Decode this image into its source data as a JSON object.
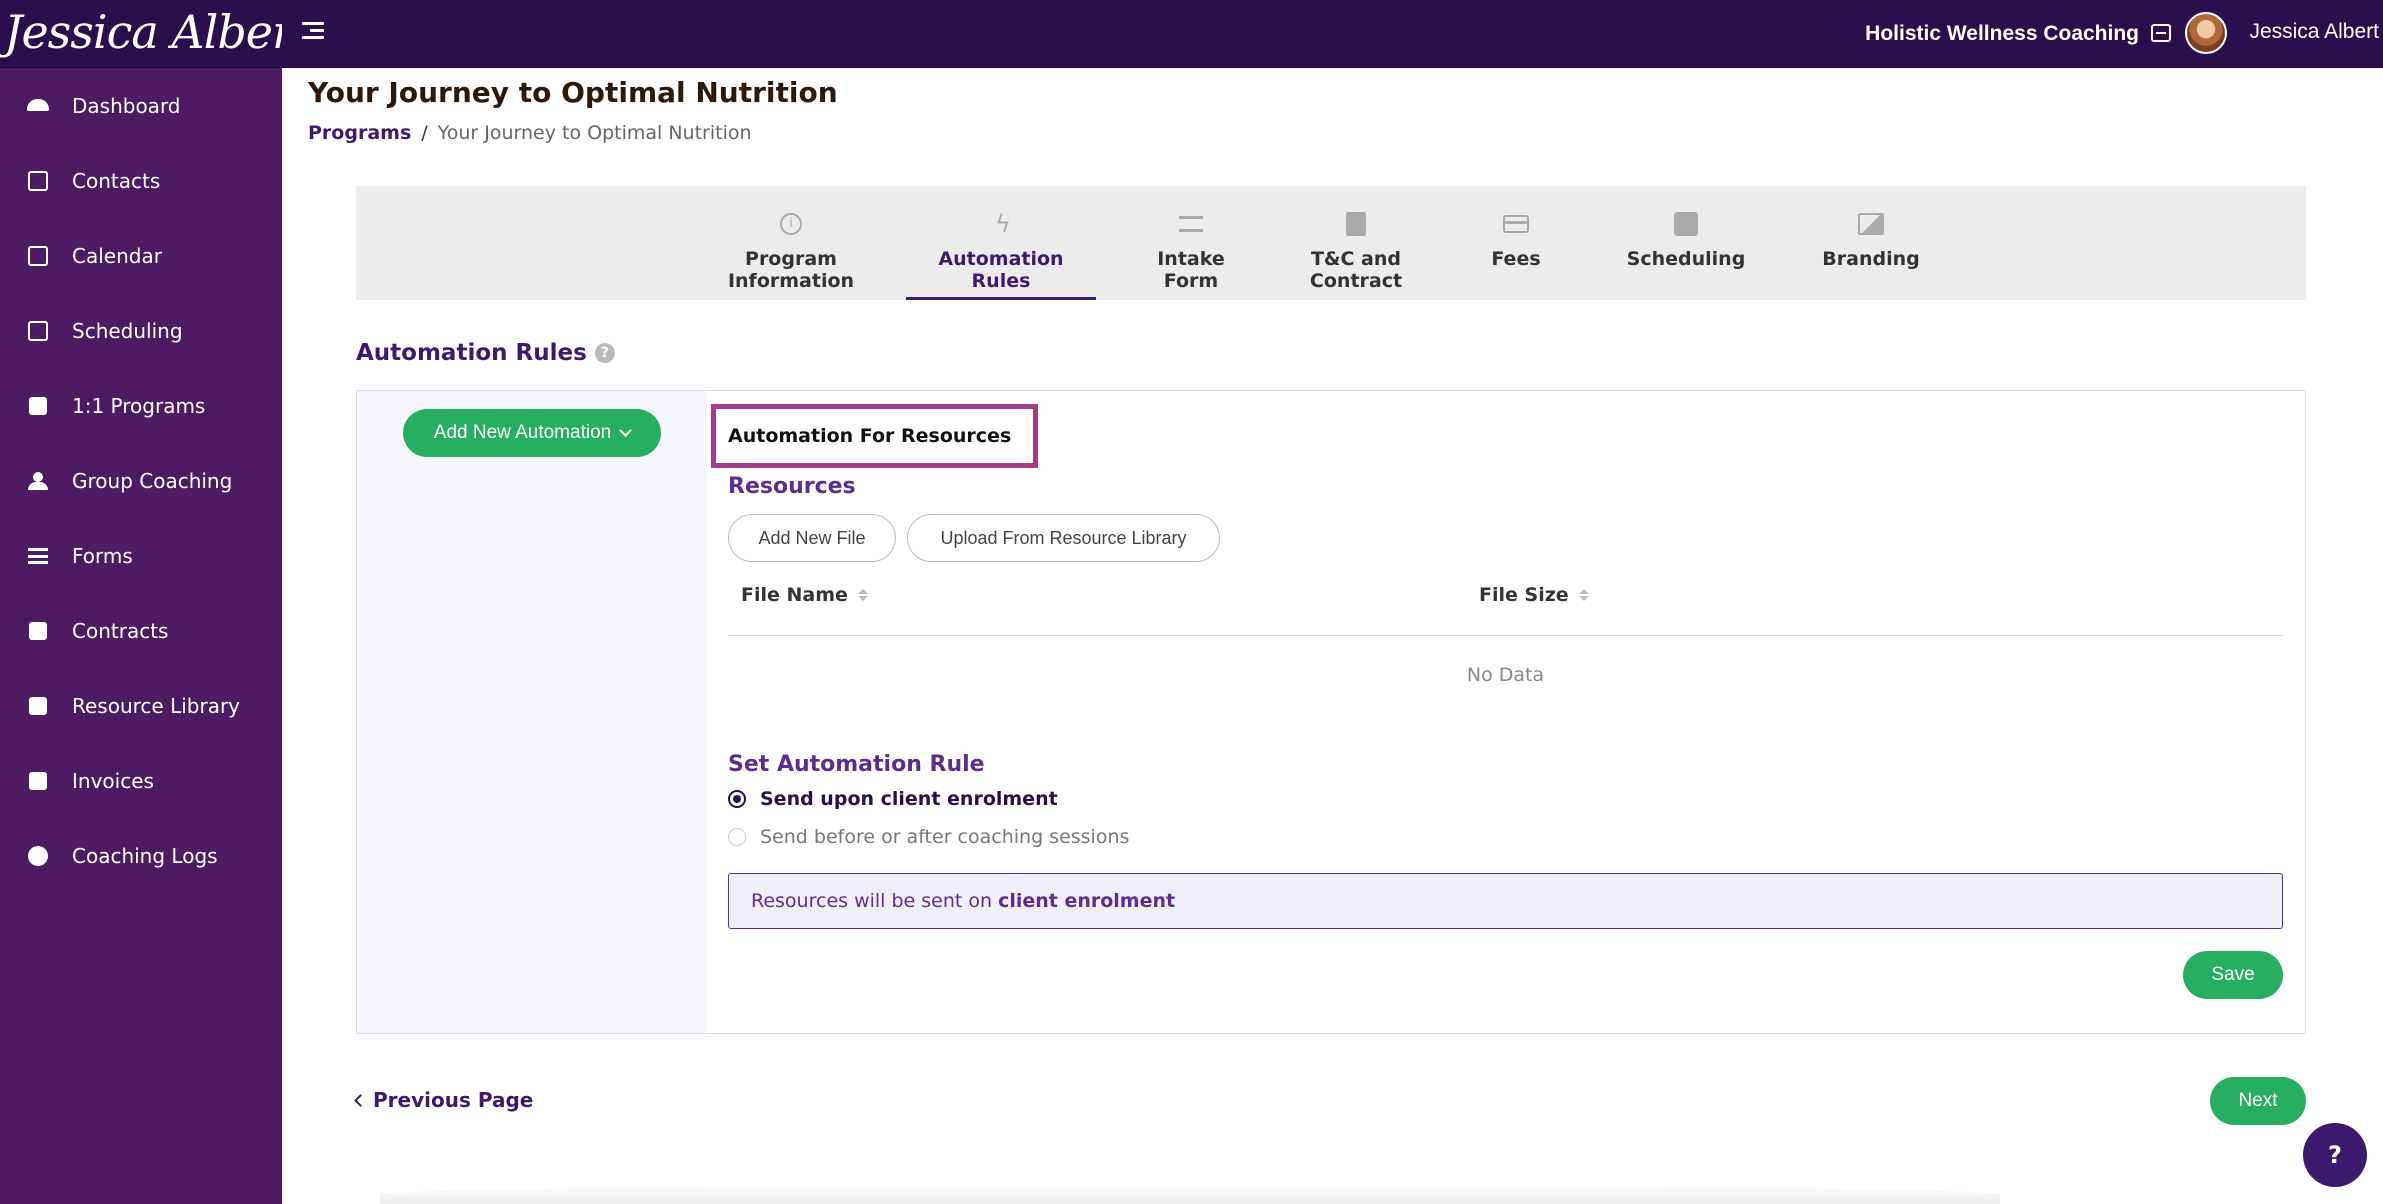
{
  "brand": {
    "logo_text": "Jessica Albert"
  },
  "topbar": {
    "org_name": "Holistic Wellness Coaching",
    "user_name": "Jessica Albert"
  },
  "sidebar": {
    "items": [
      {
        "label": "Dashboard",
        "icon": "dashboard-icon"
      },
      {
        "label": "Contacts",
        "icon": "contacts-icon"
      },
      {
        "label": "Calendar",
        "icon": "calendar-icon"
      },
      {
        "label": "Scheduling",
        "icon": "scheduling-icon"
      },
      {
        "label": "1:1 Programs",
        "icon": "book-icon"
      },
      {
        "label": "Group Coaching",
        "icon": "group-icon"
      },
      {
        "label": "Forms",
        "icon": "forms-icon"
      },
      {
        "label": "Contracts",
        "icon": "contract-sign-icon"
      },
      {
        "label": "Resource Library",
        "icon": "library-icon"
      },
      {
        "label": "Invoices",
        "icon": "invoice-icon"
      },
      {
        "label": "Coaching Logs",
        "icon": "clock-icon"
      }
    ]
  },
  "page": {
    "title": "Your Journey to Optimal Nutrition",
    "breadcrumb": {
      "link": "Programs",
      "separator": "/",
      "current": "Your Journey to Optimal Nutrition"
    }
  },
  "steps": [
    {
      "label": "Program\nInformation",
      "icon": "info-icon",
      "active": false
    },
    {
      "label": "Automation\nRules",
      "icon": "lightning-icon",
      "active": true
    },
    {
      "label": "Intake\nForm",
      "icon": "checklist-icon",
      "active": false
    },
    {
      "label": "T&C and\nContract",
      "icon": "contract-icon",
      "active": false
    },
    {
      "label": "Fees",
      "icon": "credit-card-icon",
      "active": false
    },
    {
      "label": "Scheduling",
      "icon": "calendar-check-icon",
      "active": false
    },
    {
      "label": "Branding",
      "icon": "image-icon",
      "active": false
    }
  ],
  "automation": {
    "section_title": "Automation Rules",
    "add_button": "Add New Automation",
    "panel_title": "Automation For Resources",
    "resources_title": "Resources",
    "add_file_button": "Add New File",
    "upload_button": "Upload From Resource Library",
    "table": {
      "columns": [
        "File Name",
        "File Size"
      ],
      "empty_text": "No Data"
    },
    "rule_title": "Set Automation Rule",
    "options": [
      {
        "label": "Send upon client enrolment",
        "checked": true
      },
      {
        "label": "Send before or after coaching sessions",
        "checked": false
      }
    ],
    "info_prefix": "Resources will be sent on",
    "info_emphasis": "client enrolment",
    "save_button": "Save"
  },
  "footer_nav": {
    "previous": "Previous Page",
    "next": "Next"
  },
  "help_button": "?",
  "colors": {
    "topbar": "#2a0f4d",
    "sidebar": "#4c1b62",
    "accent": "#3d1a6e",
    "green": "#27ae60",
    "highlight": "#a23c86"
  }
}
